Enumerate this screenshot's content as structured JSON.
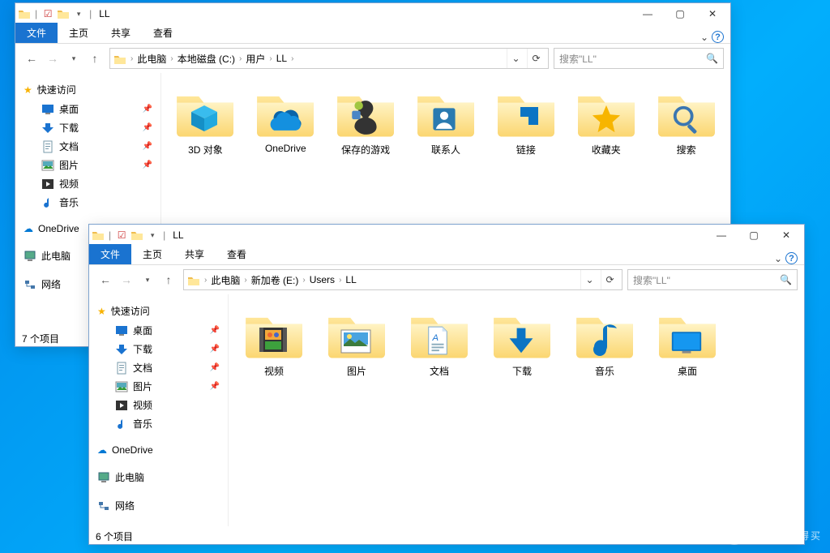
{
  "windows": [
    {
      "title": "LL",
      "ribbon": {
        "file": "文件",
        "home": "主页",
        "share": "共享",
        "view": "查看"
      },
      "breadcrumb": [
        "此电脑",
        "本地磁盘 (C:)",
        "用户",
        "LL"
      ],
      "search_placeholder": "搜索\"LL\"",
      "sidebar": {
        "quick_access": "快速访问",
        "items": [
          {
            "label": "桌面",
            "icon": "desktop",
            "pinned": true
          },
          {
            "label": "下载",
            "icon": "downloads",
            "pinned": true
          },
          {
            "label": "文档",
            "icon": "documents",
            "pinned": true
          },
          {
            "label": "图片",
            "icon": "pictures",
            "pinned": true
          },
          {
            "label": "视频",
            "icon": "videos",
            "pinned": false
          },
          {
            "label": "音乐",
            "icon": "music",
            "pinned": false
          }
        ],
        "onedrive": "OneDrive",
        "this_pc": "此电脑",
        "network": "网络"
      },
      "folders": [
        {
          "label": "3D 对象",
          "icon": "3d"
        },
        {
          "label": "OneDrive",
          "icon": "onedrive"
        },
        {
          "label": "保存的游戏",
          "icon": "games"
        },
        {
          "label": "联系人",
          "icon": "contacts"
        },
        {
          "label": "链接",
          "icon": "links"
        },
        {
          "label": "收藏夹",
          "icon": "favorites"
        },
        {
          "label": "搜索",
          "icon": "searches"
        }
      ],
      "status": "7 个项目"
    },
    {
      "title": "LL",
      "ribbon": {
        "file": "文件",
        "home": "主页",
        "share": "共享",
        "view": "查看"
      },
      "breadcrumb": [
        "此电脑",
        "新加卷 (E:)",
        "Users",
        "LL"
      ],
      "search_placeholder": "搜索\"LL\"",
      "sidebar": {
        "quick_access": "快速访问",
        "items": [
          {
            "label": "桌面",
            "icon": "desktop",
            "pinned": true
          },
          {
            "label": "下载",
            "icon": "downloads",
            "pinned": true
          },
          {
            "label": "文档",
            "icon": "documents",
            "pinned": true
          },
          {
            "label": "图片",
            "icon": "pictures",
            "pinned": true
          },
          {
            "label": "视频",
            "icon": "videos",
            "pinned": false
          },
          {
            "label": "音乐",
            "icon": "music",
            "pinned": false
          }
        ],
        "onedrive": "OneDrive",
        "this_pc": "此电脑",
        "network": "网络"
      },
      "folders": [
        {
          "label": "视频",
          "icon": "videos-large"
        },
        {
          "label": "图片",
          "icon": "pictures-large"
        },
        {
          "label": "文档",
          "icon": "documents-large"
        },
        {
          "label": "下载",
          "icon": "downloads-large"
        },
        {
          "label": "音乐",
          "icon": "music-large"
        },
        {
          "label": "桌面",
          "icon": "desktop-large"
        }
      ],
      "status": "6 个项目"
    }
  ],
  "watermark": "值·什么值得买"
}
